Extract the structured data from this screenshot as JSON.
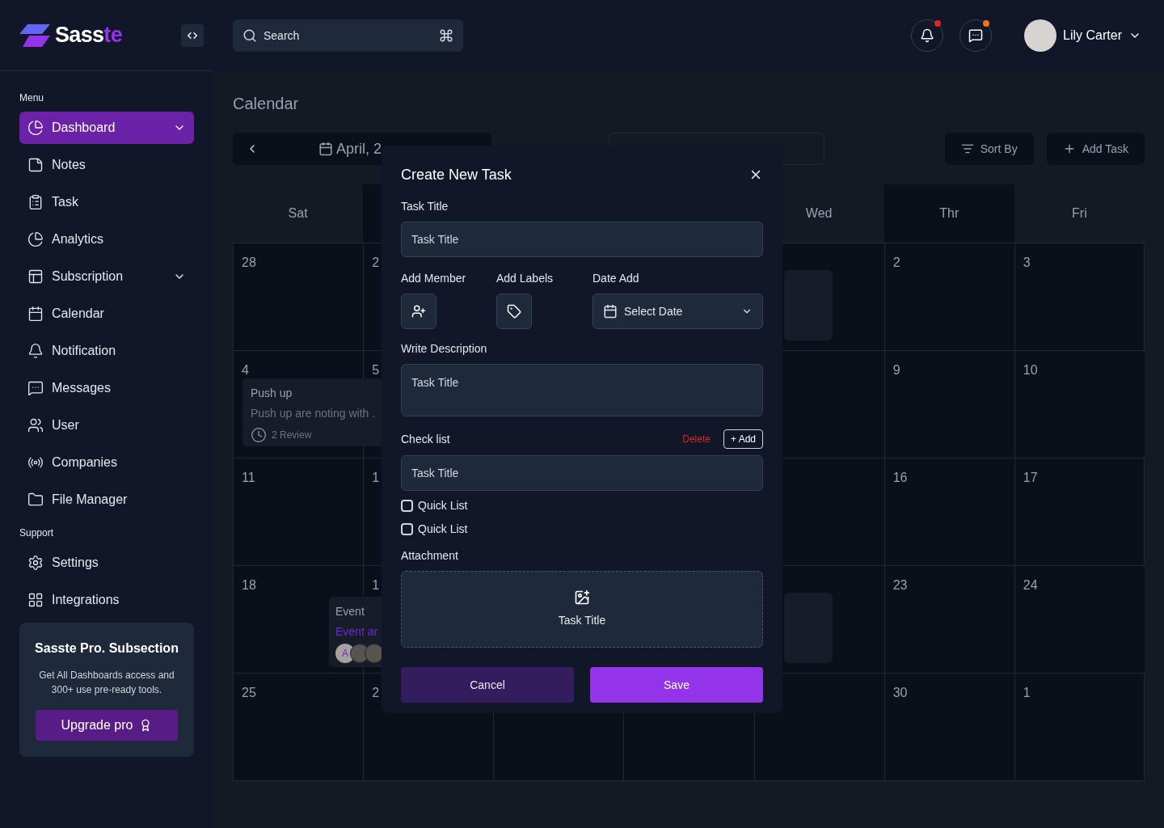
{
  "brand": {
    "name_main": "Sass",
    "name_accent": "te"
  },
  "header": {
    "search": {
      "placeholder": "Search"
    },
    "notices": [
      {
        "color": "#dc2626"
      },
      {
        "color": "#f97316"
      }
    ],
    "user": {
      "name": "Lily Carter"
    }
  },
  "sidebar": {
    "sections": [
      {
        "title": "Menu",
        "items": [
          {
            "label": "Dashboard",
            "selected": true,
            "submenu": true
          },
          {
            "label": "Notes",
            "selected": false,
            "submenu": false
          },
          {
            "label": "Task",
            "selected": false,
            "submenu": false
          },
          {
            "label": "Analytics",
            "selected": false,
            "submenu": false
          },
          {
            "label": "Subscription",
            "selected": false,
            "submenu": true
          },
          {
            "label": "Calendar",
            "selected": false,
            "submenu": false
          },
          {
            "label": "Notification",
            "selected": false,
            "submenu": false
          },
          {
            "label": "Messages",
            "selected": false,
            "submenu": false
          },
          {
            "label": "User",
            "selected": false,
            "submenu": false
          },
          {
            "label": "Companies",
            "selected": false,
            "submenu": false
          },
          {
            "label": "File Manager",
            "selected": false,
            "submenu": false
          }
        ]
      },
      {
        "title": "Support",
        "items": [
          {
            "label": "Settings",
            "selected": false,
            "submenu": false
          },
          {
            "label": "Integrations",
            "selected": false,
            "submenu": false
          }
        ]
      }
    ],
    "promo": {
      "title": "Sasste Pro. Subsection",
      "text": "Get All Dashboards access and 300+ use pre-ready tools.",
      "button": "Upgrade pro"
    }
  },
  "page": {
    "title": "Calendar",
    "month": "April, 2",
    "sort_button": "Sort By",
    "add_button": "Add Task"
  },
  "calendar": {
    "columns_left": [
      "Sat"
    ],
    "columns_right": [
      "Wed",
      "Thr",
      "Fri"
    ],
    "weeks": [
      {
        "left": [
          {
            "date": "28"
          },
          {
            "date": "2"
          }
        ],
        "right": [
          {
            "date": "2"
          },
          {
            "date": "3"
          }
        ]
      },
      {
        "left": [
          {
            "date": "4"
          },
          {
            "date": "5"
          }
        ],
        "right": [
          {
            "date": "9"
          },
          {
            "date": "10"
          }
        ],
        "event": {
          "kind": "task",
          "title": "Push up",
          "text": "Push up are noting with .",
          "meta": "2 Review"
        }
      },
      {
        "left": [
          {
            "date": "11"
          },
          {
            "date": "1"
          }
        ],
        "right": [
          {
            "date": "16"
          },
          {
            "date": "17"
          }
        ]
      },
      {
        "left": [
          {
            "date": "18"
          },
          {
            "date": "1"
          }
        ],
        "right": [
          {
            "date": "23"
          },
          {
            "date": "24"
          }
        ],
        "event": {
          "kind": "event",
          "title": "Event",
          "text": "Event ar",
          "avatars": [
            {
              "kind": "initial",
              "initial": "A"
            },
            {
              "kind": "photo"
            },
            {
              "kind": "photo"
            }
          ]
        }
      },
      {
        "left": [
          {
            "date": "25"
          },
          {
            "date": "2"
          }
        ],
        "right": [
          {
            "date": "30"
          },
          {
            "date": "1"
          }
        ]
      }
    ]
  },
  "modal": {
    "title": "Create New Task",
    "task_title": {
      "label": "Task Title",
      "placeholder": "Task Title"
    },
    "member_label": "Add Member",
    "labels_label": "Add Labels",
    "date": {
      "label": "Date Add",
      "placeholder": "Select Date"
    },
    "description": {
      "label": "Write Description",
      "placeholder": "Task Title"
    },
    "checklist": {
      "label": "Check list",
      "delete": "Delete",
      "add": "+ Add",
      "placeholder": "Task Title",
      "items": [
        {
          "label": "Quick List",
          "checked": false
        },
        {
          "label": "Quick List",
          "checked": false
        }
      ]
    },
    "attachment": {
      "label": "Attachment",
      "text": "Task Title"
    },
    "cancel": "Cancel",
    "save": "Save"
  }
}
